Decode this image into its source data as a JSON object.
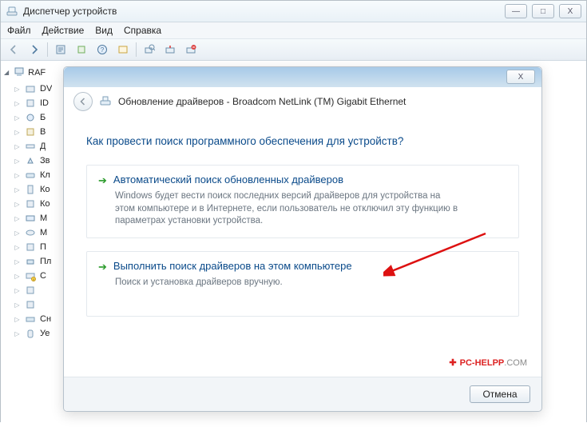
{
  "window": {
    "title": "Диспетчер устройств",
    "win_buttons": {
      "min": "—",
      "max": "□",
      "close": "X"
    }
  },
  "menu": {
    "file": "Файл",
    "action": "Действие",
    "view": "Вид",
    "help": "Справка"
  },
  "tree": {
    "root": "RAF",
    "nodes": [
      {
        "label": "DV"
      },
      {
        "label": "ID"
      },
      {
        "label": "Б"
      },
      {
        "label": "В"
      },
      {
        "label": "Д"
      },
      {
        "label": "Зв"
      },
      {
        "label": "Кл"
      },
      {
        "label": "Ко"
      },
      {
        "label": "Ко"
      },
      {
        "label": "М"
      },
      {
        "label": "М"
      },
      {
        "label": "П"
      },
      {
        "label": "Пл"
      },
      {
        "label": "С"
      },
      {
        "label": ""
      },
      {
        "label": ""
      },
      {
        "label": "Сн"
      },
      {
        "label": "Уе"
      }
    ]
  },
  "dialog": {
    "title": "Обновление драйверов - Broadcom NetLink (TM) Gigabit Ethernet",
    "subtitle": "Как провести поиск программного обеспечения для устройств?",
    "close": "X",
    "options": [
      {
        "title": "Автоматический поиск обновленных драйверов",
        "desc": "Windows будет вести поиск последних версий драйверов для устройства на этом компьютере и в Интернете, если пользователь не отключил эту функцию в параметрах установки устройства."
      },
      {
        "title": "Выполнить поиск драйверов на этом компьютере",
        "desc": "Поиск и установка драйверов вручную."
      }
    ],
    "cancel": "Отмена"
  },
  "watermark": {
    "brand": "PC-HELPP",
    "suffix": ".COM"
  }
}
